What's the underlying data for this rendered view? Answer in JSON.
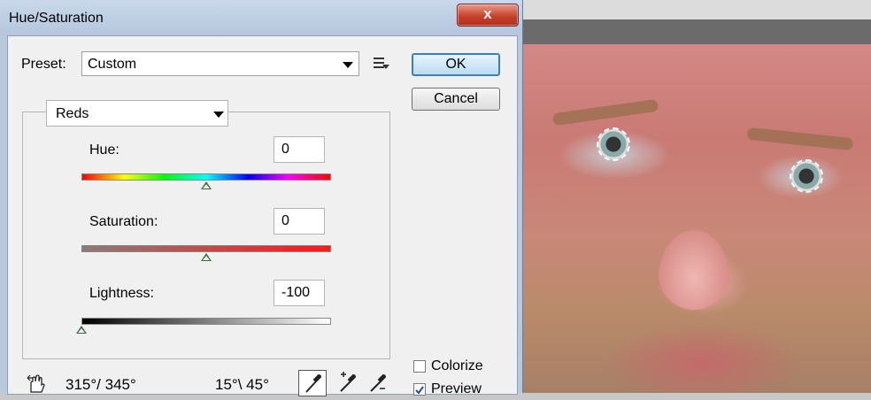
{
  "dialog": {
    "title": "Hue/Saturation",
    "close_label": "x",
    "preset_label": "Preset:",
    "preset_value": "Custom",
    "ok_label": "OK",
    "cancel_label": "Cancel",
    "channel_value": "Reds",
    "hue": {
      "label": "Hue:",
      "value": "0",
      "position": 0.5
    },
    "saturation": {
      "label": "Saturation:",
      "value": "0",
      "position": 0.5
    },
    "lightness": {
      "label": "Lightness:",
      "value": "-100",
      "position": 0.0
    },
    "range_left": "315°/ 345°",
    "range_right": "15°\\ 45°",
    "colorize_label": "Colorize",
    "colorize_checked": false,
    "preview_label": "Preview",
    "preview_checked": true
  },
  "icons": {
    "hand": "hand-adjust-icon",
    "eyedropper": "eyedropper-icon",
    "eyedropper_plus": "eyedropper-plus-icon",
    "eyedropper_minus": "eyedropper-minus-icon",
    "preset_menu": "preset-options-icon"
  }
}
